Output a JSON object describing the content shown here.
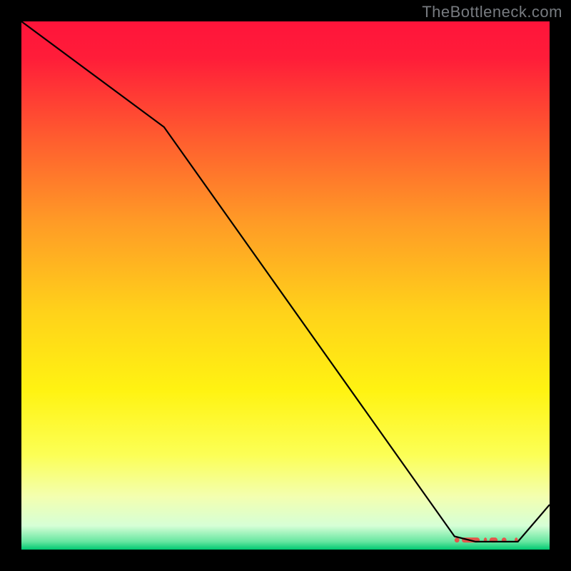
{
  "watermark": "TheBottleneck.com",
  "chart_data": {
    "type": "line",
    "x": [
      0.0,
      0.27,
      0.82,
      0.86,
      0.94,
      1.0
    ],
    "y": [
      1.0,
      0.8,
      0.025,
      0.015,
      0.015,
      0.085
    ],
    "title": "",
    "xlabel": "",
    "ylabel": "",
    "xlim": [
      0,
      1
    ],
    "ylim": [
      0,
      1
    ],
    "grid": false,
    "legend": false,
    "annotations": {
      "marker_band": {
        "x_start": 0.82,
        "x_end": 0.94,
        "y": 0.018,
        "color": "#e2574c"
      }
    }
  },
  "gradient": {
    "stops": [
      {
        "offset": 0.0,
        "color": "#ff143a"
      },
      {
        "offset": 0.07,
        "color": "#ff1d39"
      },
      {
        "offset": 0.22,
        "color": "#ff5c2f"
      },
      {
        "offset": 0.38,
        "color": "#ff9b26"
      },
      {
        "offset": 0.55,
        "color": "#ffd21a"
      },
      {
        "offset": 0.7,
        "color": "#fff312"
      },
      {
        "offset": 0.82,
        "color": "#fcff55"
      },
      {
        "offset": 0.9,
        "color": "#f3ffb0"
      },
      {
        "offset": 0.955,
        "color": "#d6ffd6"
      },
      {
        "offset": 0.985,
        "color": "#66e6a0"
      },
      {
        "offset": 1.0,
        "color": "#00c972"
      }
    ]
  },
  "marker_color": "#e2574c",
  "line_color": "#000000"
}
